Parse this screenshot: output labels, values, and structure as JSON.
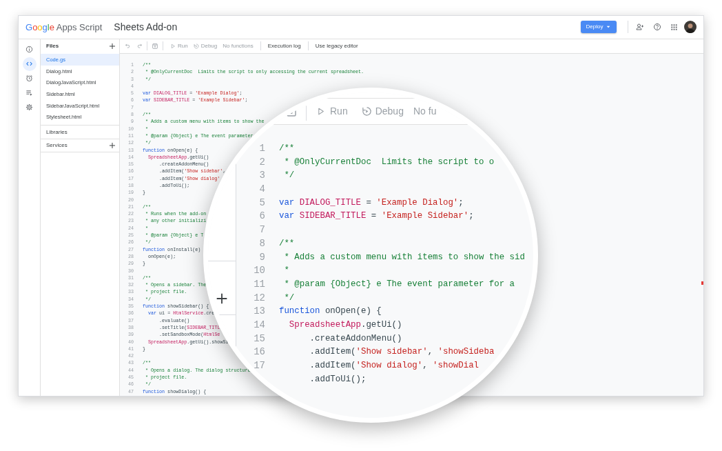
{
  "header": {
    "logo": {
      "brand": "Google",
      "product": "Apps Script"
    },
    "project_title": "Sheets Add-on",
    "deploy_button": "Deploy"
  },
  "rail": [
    {
      "selected": false
    },
    {
      "selected": true
    },
    {
      "selected": false
    },
    {
      "selected": false
    },
    {
      "selected": false
    }
  ],
  "files_panel": {
    "title": "Files",
    "files": [
      {
        "name": "Code.gs",
        "selected": true
      },
      {
        "name": "Dialog.html",
        "selected": false
      },
      {
        "name": "DialogJavaScript.html",
        "selected": false
      },
      {
        "name": "Sidebar.html",
        "selected": false
      },
      {
        "name": "SidebarJavaScript.html",
        "selected": false
      },
      {
        "name": "Stylesheet.html",
        "selected": false
      }
    ],
    "sections": [
      {
        "label": "Libraries",
        "addable": false
      },
      {
        "label": "Services",
        "addable": true
      }
    ]
  },
  "toolbar": {
    "run": {
      "label": "Run",
      "disabled": true
    },
    "debug": {
      "label": "Debug",
      "disabled": true
    },
    "function_select": {
      "label": "No functions",
      "disabled": true
    },
    "execution_log": {
      "label": "Execution log",
      "disabled": false
    },
    "legacy_editor": {
      "label": "Use legacy editor",
      "disabled": false
    }
  },
  "code_lines": [
    {
      "number": "1",
      "tokens": [
        {
          "kind": "comment",
          "text": "/**"
        }
      ]
    },
    {
      "number": "2",
      "tokens": [
        {
          "kind": "comment",
          "text": " * @OnlyCurrentDoc  Limits the script to only accessing the current spreadsheet."
        }
      ]
    },
    {
      "number": "3",
      "tokens": [
        {
          "kind": "comment",
          "text": " */"
        }
      ]
    },
    {
      "number": "4"
    },
    {
      "number": "5",
      "tokens": [
        {
          "kind": "keyword",
          "text": "var"
        },
        {
          "kind": "constant",
          "text": " DIALOG_TITLE"
        },
        {
          "kind": "plain",
          "text": " = "
        },
        {
          "kind": "string",
          "text": "'Example Dialog'"
        },
        {
          "kind": "plain",
          "text": ";"
        }
      ]
    },
    {
      "number": "6",
      "tokens": [
        {
          "kind": "keyword",
          "text": "var"
        },
        {
          "kind": "constant",
          "text": " SIDEBAR_TITLE"
        },
        {
          "kind": "plain",
          "text": " = "
        },
        {
          "kind": "string",
          "text": "'Example Sidebar'"
        },
        {
          "kind": "plain",
          "text": ";"
        }
      ]
    },
    {
      "number": "7"
    },
    {
      "number": "8",
      "tokens": [
        {
          "kind": "comment",
          "text": "/**"
        }
      ]
    },
    {
      "number": "9",
      "tokens": [
        {
          "kind": "comment",
          "text": " * Adds a custom menu with items to show the"
        }
      ]
    },
    {
      "number": "10",
      "tokens": [
        {
          "kind": "comment",
          "text": " *"
        }
      ]
    },
    {
      "number": "11",
      "tokens": [
        {
          "kind": "comment",
          "text": " * @param {Object} e The event parameter"
        }
      ]
    },
    {
      "number": "12",
      "tokens": [
        {
          "kind": "comment",
          "text": " */"
        }
      ]
    },
    {
      "number": "13",
      "tokens": [
        {
          "kind": "keyword",
          "text": "function"
        },
        {
          "kind": "plain",
          "text": " onOpen(e) {"
        }
      ]
    },
    {
      "number": "14",
      "tokens": [
        {
          "kind": "constant",
          "text": "  SpreadsheetApp"
        },
        {
          "kind": "plain",
          "text": ".getUi()"
        }
      ]
    },
    {
      "number": "15",
      "tokens": [
        {
          "kind": "plain",
          "text": "      .createAddonMenu()"
        }
      ]
    },
    {
      "number": "16",
      "tokens": [
        {
          "kind": "plain",
          "text": "      .addItem("
        },
        {
          "kind": "string",
          "text": "'Show sidebar'"
        },
        {
          "kind": "plain",
          "text": ","
        }
      ]
    },
    {
      "number": "17",
      "tokens": [
        {
          "kind": "plain",
          "text": "      .addItem("
        },
        {
          "kind": "string",
          "text": "'Show dialog'"
        }
      ]
    },
    {
      "number": "18",
      "tokens": [
        {
          "kind": "plain",
          "text": "      .addToUi();"
        }
      ]
    },
    {
      "number": "19",
      "tokens": [
        {
          "kind": "plain",
          "text": "}"
        }
      ]
    },
    {
      "number": "20"
    },
    {
      "number": "21",
      "tokens": [
        {
          "kind": "comment",
          "text": "/**"
        }
      ]
    },
    {
      "number": "22",
      "tokens": [
        {
          "kind": "comment",
          "text": " * Runs when the add-on"
        }
      ]
    },
    {
      "number": "23",
      "tokens": [
        {
          "kind": "comment",
          "text": " * any other initializi"
        }
      ]
    },
    {
      "number": "24",
      "tokens": [
        {
          "kind": "comment",
          "text": " *"
        }
      ]
    },
    {
      "number": "25",
      "tokens": [
        {
          "kind": "comment",
          "text": " * @param {Object} e T"
        }
      ]
    },
    {
      "number": "26",
      "tokens": [
        {
          "kind": "comment",
          "text": " */"
        }
      ]
    },
    {
      "number": "27",
      "tokens": [
        {
          "kind": "keyword",
          "text": "function"
        },
        {
          "kind": "plain",
          "text": " onInstall(e)"
        }
      ]
    },
    {
      "number": "28",
      "tokens": [
        {
          "kind": "plain",
          "text": "  onOpen(e);"
        }
      ]
    },
    {
      "number": "29",
      "tokens": [
        {
          "kind": "plain",
          "text": "}"
        }
      ]
    },
    {
      "number": "30"
    },
    {
      "number": "31",
      "tokens": [
        {
          "kind": "comment",
          "text": "/**"
        }
      ]
    },
    {
      "number": "32",
      "tokens": [
        {
          "kind": "comment",
          "text": " * Opens a sidebar. The"
        }
      ]
    },
    {
      "number": "33",
      "tokens": [
        {
          "kind": "comment",
          "text": " * project file."
        }
      ]
    },
    {
      "number": "34",
      "tokens": [
        {
          "kind": "comment",
          "text": " */"
        }
      ]
    },
    {
      "number": "35",
      "tokens": [
        {
          "kind": "keyword",
          "text": "function"
        },
        {
          "kind": "plain",
          "text": " showSidebar() {"
        }
      ]
    },
    {
      "number": "36",
      "tokens": [
        {
          "kind": "keyword",
          "text": "  var"
        },
        {
          "kind": "plain",
          "text": " ui = "
        },
        {
          "kind": "constant",
          "text": "HtmlService"
        },
        {
          "kind": "plain",
          "text": ".cre"
        }
      ]
    },
    {
      "number": "37",
      "tokens": [
        {
          "kind": "plain",
          "text": "      .evaluate()"
        }
      ]
    },
    {
      "number": "38",
      "tokens": [
        {
          "kind": "plain",
          "text": "      .setTitle("
        },
        {
          "kind": "constant",
          "text": "SIDEBAR_TITL"
        }
      ]
    },
    {
      "number": "39",
      "tokens": [
        {
          "kind": "plain",
          "text": "      .setSandboxMode("
        },
        {
          "kind": "constant",
          "text": "HtmlSe"
        }
      ]
    },
    {
      "number": "40",
      "tokens": [
        {
          "kind": "constant",
          "text": "  SpreadsheetApp"
        },
        {
          "kind": "plain",
          "text": ".getUi().showSi"
        }
      ]
    },
    {
      "number": "41",
      "tokens": [
        {
          "kind": "plain",
          "text": "}"
        }
      ]
    },
    {
      "number": "42"
    },
    {
      "number": "43",
      "tokens": [
        {
          "kind": "comment",
          "text": "/**"
        }
      ]
    },
    {
      "number": "44",
      "tokens": [
        {
          "kind": "comment",
          "text": " * Opens a dialog. The dialog structure"
        }
      ]
    },
    {
      "number": "45",
      "tokens": [
        {
          "kind": "comment",
          "text": " * project file."
        }
      ]
    },
    {
      "number": "46",
      "tokens": [
        {
          "kind": "comment",
          "text": " */"
        }
      ]
    },
    {
      "number": "47",
      "tokens": [
        {
          "kind": "keyword",
          "text": "function"
        },
        {
          "kind": "plain",
          "text": " showDialog() {"
        }
      ]
    }
  ],
  "magnifier": {
    "toolbar": {
      "run": "Run",
      "debug": "Debug",
      "function_select": "No fu"
    },
    "code_lines": [
      {
        "number": "1",
        "tokens": [
          {
            "kind": "comment",
            "text": "/**"
          }
        ]
      },
      {
        "number": "2",
        "tokens": [
          {
            "kind": "comment",
            "text": " * @OnlyCurrentDoc  Limits the script to o"
          }
        ]
      },
      {
        "number": "3",
        "tokens": [
          {
            "kind": "comment",
            "text": " */"
          }
        ]
      },
      {
        "number": "4"
      },
      {
        "number": "5",
        "tokens": [
          {
            "kind": "keyword",
            "text": "var"
          },
          {
            "kind": "constant",
            "text": " DIALOG_TITLE"
          },
          {
            "kind": "plain",
            "text": " = "
          },
          {
            "kind": "string",
            "text": "'Example Dialog'"
          },
          {
            "kind": "plain",
            "text": ";"
          }
        ]
      },
      {
        "number": "6",
        "tokens": [
          {
            "kind": "keyword",
            "text": "var"
          },
          {
            "kind": "constant",
            "text": " SIDEBAR_TITLE"
          },
          {
            "kind": "plain",
            "text": " = "
          },
          {
            "kind": "string",
            "text": "'Example Sidebar'"
          },
          {
            "kind": "plain",
            "text": ";"
          }
        ]
      },
      {
        "number": "7"
      },
      {
        "number": "8",
        "tokens": [
          {
            "kind": "comment",
            "text": "/**"
          }
        ]
      },
      {
        "number": "9",
        "tokens": [
          {
            "kind": "comment",
            "text": " * Adds a custom menu with items to show the sid"
          }
        ]
      },
      {
        "number": "10",
        "tokens": [
          {
            "kind": "comment",
            "text": " *"
          }
        ]
      },
      {
        "number": "11",
        "tokens": [
          {
            "kind": "comment",
            "text": " * @param {Object} e The event parameter for a"
          }
        ]
      },
      {
        "number": "12",
        "tokens": [
          {
            "kind": "comment",
            "text": " */"
          }
        ]
      },
      {
        "number": "13",
        "tokens": [
          {
            "kind": "keyword",
            "text": "function"
          },
          {
            "kind": "plain",
            "text": " onOpen(e) {"
          }
        ]
      },
      {
        "number": "14",
        "tokens": [
          {
            "kind": "constant",
            "text": "  SpreadsheetApp"
          },
          {
            "kind": "plain",
            "text": ".getUi()"
          }
        ]
      },
      {
        "number": "15",
        "tokens": [
          {
            "kind": "plain",
            "text": "      .createAddonMenu()"
          }
        ]
      },
      {
        "number": "16",
        "tokens": [
          {
            "kind": "plain",
            "text": "      .addItem("
          },
          {
            "kind": "string",
            "text": "'Show sidebar'"
          },
          {
            "kind": "plain",
            "text": ", "
          },
          {
            "kind": "string",
            "text": "'showSideba"
          }
        ]
      },
      {
        "number": "17",
        "tokens": [
          {
            "kind": "plain",
            "text": "      .addItem("
          },
          {
            "kind": "string",
            "text": "'Show dialog'"
          },
          {
            "kind": "plain",
            "text": ", "
          },
          {
            "kind": "string",
            "text": "'showDial"
          }
        ]
      },
      {
        "tokens": [
          {
            "kind": "plain",
            "text": "      .addToUi();"
          }
        ]
      }
    ]
  }
}
